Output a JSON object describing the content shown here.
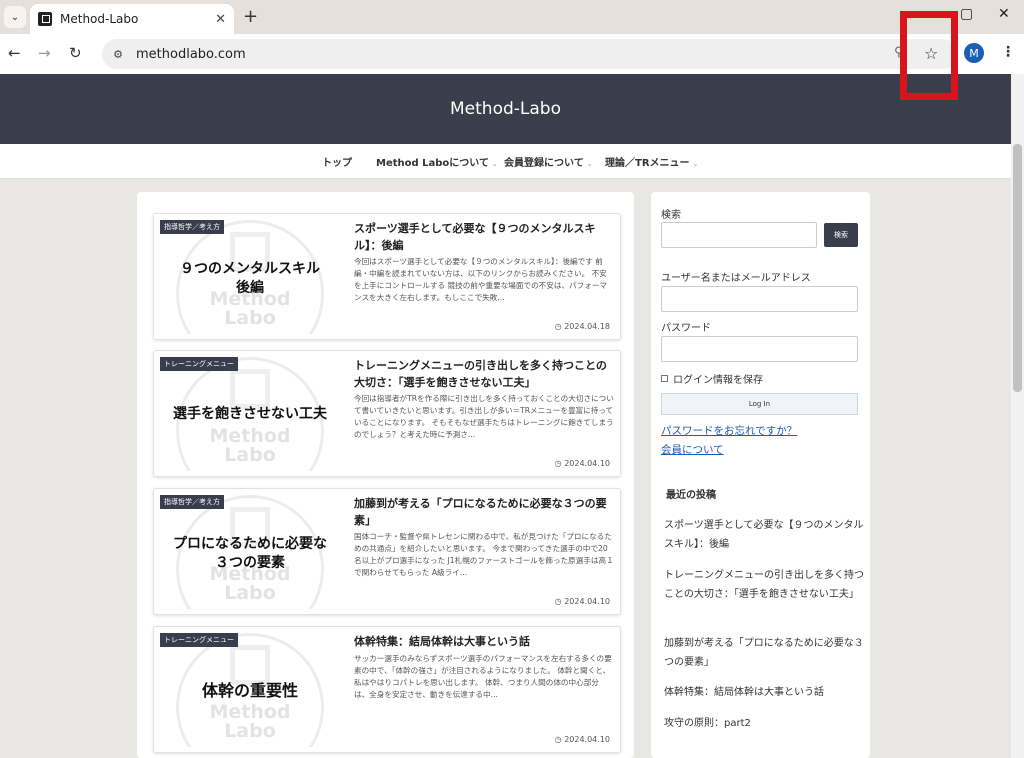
{
  "browser": {
    "tab_title": "Method-Labo",
    "url": "methodlabo.com",
    "avatar_letter": "M"
  },
  "site": {
    "title": "Method-Labo",
    "nav": [
      {
        "label": "トップ"
      },
      {
        "label": "Method Laboについて"
      },
      {
        "label": "会員登録について"
      },
      {
        "label": "理論／TRメニュー"
      }
    ]
  },
  "posts": [
    {
      "category": "指導哲学／考え方",
      "thumb_text": "９つのメンタルスキル\n後編",
      "title": "スポーツ選手として必要な【９つのメンタルスキル】：後編",
      "excerpt": "今回はスポーツ選手として必要な【９つのメンタルスキル】：後編です 前編・中編を読まれていない方は、以下のリンクからお読みください。 不安を上手にコントロールする 競技の前や重要な場面での不安は、パフォーマンスを大きく左右します。もしここで失敗...",
      "date": "2024.04.18"
    },
    {
      "category": "トレーニングメニュー",
      "thumb_text": "選手を飽きさせない工夫",
      "title": "トレーニングメニューの引き出しを多く持つことの大切さ：「選手を飽きさせない工夫」",
      "excerpt": "今回は指導者がTRを作る際に引き出しを多く持っておくことの大切さについて書いていきたいと思います。引き出しが多い＝TRメニューを豊富に持っていることになります。 そもそもなぜ選手たちはトレーニングに飽きてしまうのでしょう？と考えた時に予測さ...",
      "date": "2024.04.10"
    },
    {
      "category": "指導哲学／考え方",
      "thumb_text": "プロになるために必要な\n３つの要素",
      "title": "加藤到が考える「プロになるために必要な３つの要素」",
      "excerpt": "国体コーチ・監督や県トレセンに関わる中で、私が見つけた「プロになるための共通点」を紹介したいと思います。 今まで関わってきた選手の中で20名以上がプロ選手になった J1札幌のファーストゴールを飾った原選手は高１で関わらせてもらった A級ライ...",
      "date": "2024.04.10"
    },
    {
      "category": "トレーニングメニュー",
      "thumb_text": "体幹の重要性",
      "title": "体幹特集：結局体幹は大事という話",
      "excerpt": "サッカー選手のみならずスポーツ選手のパフォーマンスを左右する多くの要素の中で、「体幹の強さ」が注目されるようになりました。 体幹と聞くと、私はやはりコパトレを思い出します。 体幹、つまり人間の体の中心部分は、全身を安定させ、動きを伝達する中...",
      "date": "2024.04.10"
    }
  ],
  "thumb_logo": "Method\nLabo",
  "sidebar": {
    "search_label": "検索",
    "search_button": "検索",
    "username_label": "ユーザー名またはメールアドレス",
    "password_label": "パスワード",
    "remember_label": "ログイン情報を保存",
    "login_button": "Log In",
    "forgot_link": "パスワードをお忘れですか？",
    "member_link": "会員について",
    "recent_heading": "最近の投稿",
    "recent_posts": [
      "スポーツ選手として必要な【９つのメンタルスキル】：後編",
      "トレーニングメニューの引き出しを多く持つことの大切さ：「選手を飽きさせない工夫」",
      "加藤到が考える「プロになるために必要な３つの要素」",
      "体幹特集：結局体幹は大事という話",
      "攻守の原則：part2"
    ]
  }
}
